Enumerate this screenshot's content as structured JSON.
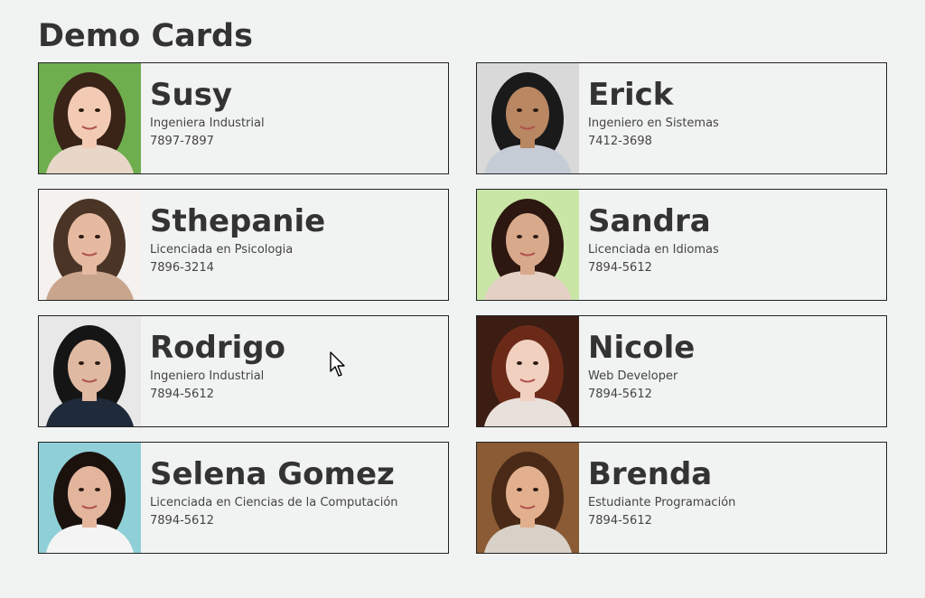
{
  "page": {
    "title": "Demo Cards"
  },
  "cards": [
    {
      "name": "Susy",
      "role": "Ingeniera Industrial",
      "phone": "7897-7897",
      "avatar_icon": "person-photo-icon",
      "palette": {
        "bg": "#6fae4e",
        "hair": "#3a2418",
        "skin": "#f3cbb4",
        "shirt": "#e8d7c8"
      }
    },
    {
      "name": "Erick",
      "role": "Ingeniero en Sistemas",
      "phone": "7412-3698",
      "avatar_icon": "person-photo-icon",
      "palette": {
        "bg": "#d9d9d9",
        "hair": "#1a1a1a",
        "skin": "#b98762",
        "shirt": "#c5ccd6"
      }
    },
    {
      "name": "Sthepanie",
      "role": "Licenciada en Psicologia",
      "phone": "7896-3214",
      "avatar_icon": "person-photo-icon",
      "palette": {
        "bg": "#f4f1ee",
        "hair": "#4a3426",
        "skin": "#e6b9a1",
        "shirt": "#caa58e"
      }
    },
    {
      "name": "Sandra",
      "role": "Licenciada en Idiomas",
      "phone": "7894-5612",
      "avatar_icon": "person-photo-icon",
      "palette": {
        "bg": "#c9e6a6",
        "hair": "#2c1810",
        "skin": "#d9a98c",
        "shirt": "#e4d0c4"
      }
    },
    {
      "name": "Rodrigo",
      "role": "Ingeniero Industrial",
      "phone": "7894-5612",
      "avatar_icon": "person-photo-icon",
      "palette": {
        "bg": "#e8e8e8",
        "hair": "#151515",
        "skin": "#e0b9a2",
        "shirt": "#1f2a3a"
      }
    },
    {
      "name": "Nicole",
      "role": "Web Developer",
      "phone": "7894-5612",
      "avatar_icon": "person-photo-icon",
      "palette": {
        "bg": "#3b1d14",
        "hair": "#6b2a18",
        "skin": "#f1d0c0",
        "shirt": "#e8e0da"
      }
    },
    {
      "name": "Selena Gomez",
      "role": "Licenciada en Ciencias de la Computación",
      "phone": "7894-5612",
      "avatar_icon": "person-photo-icon",
      "palette": {
        "bg": "#8fd0d8",
        "hair": "#1b120e",
        "skin": "#e3b59d",
        "shirt": "#f4f4f4"
      }
    },
    {
      "name": "Brenda",
      "role": "Estudiante Programación",
      "phone": "7894-5612",
      "avatar_icon": "person-photo-icon",
      "palette": {
        "bg": "#8a5b34",
        "hair": "#4a2a16",
        "skin": "#e2b08e",
        "shirt": "#d8d1c8"
      }
    }
  ],
  "cursor": {
    "icon": "mouse-pointer-icon"
  }
}
